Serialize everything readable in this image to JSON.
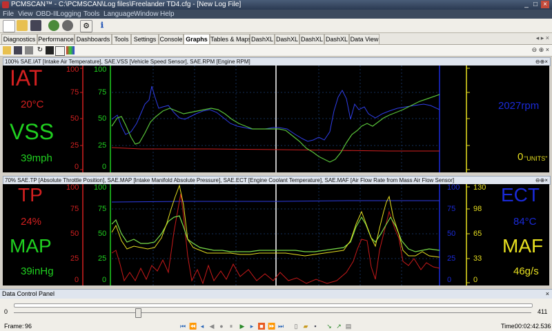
{
  "window": {
    "title": "PCMSCAN™ - C:\\PCMSCAN\\Log files\\Freelander TD4.cfg - [New Log File]"
  },
  "menu": [
    "File",
    "View",
    "OBD-II",
    "Logging",
    "Tools",
    "Language",
    "Window",
    "Help"
  ],
  "tabs": [
    "Diagnostics",
    "Performance",
    "Dashboards",
    "Tools",
    "Settings",
    "Console",
    "Graphs",
    "Tables & Maps",
    "DashXL",
    "DashXL",
    "DashXL",
    "DashXL",
    "Data View"
  ],
  "active_tab": "Graphs",
  "colors": {
    "red": "#d42020",
    "green": "#20d020",
    "blue": "#1a2ad8",
    "yellow": "#e8e020",
    "white": "#ffffff"
  },
  "graph1": {
    "header": "100% SAE.IAT [Intake Air Temperature], SAE.VSS [Vehicle Speed Sensor], SAE.RPM [Engine RPM]",
    "iat_label": "IAT",
    "iat_value": "20°C",
    "vss_label": "VSS",
    "vss_value": "39mph",
    "rpm_value": "2027rpm",
    "units_value": "0",
    "units_label": "\"UNITS\"",
    "red_axis": [
      "100",
      "75",
      "50",
      "25",
      "0"
    ],
    "green_axis": [
      "100",
      "75",
      "50",
      "25",
      "0"
    ]
  },
  "graph2": {
    "header": "70% SAE.TP [Absolute Throttle Position], SAE.MAP [Intake Manifold Absolute Pressure], SAE.ECT [Engine Coolant Temperature], SAE.MAF [Air Flow Rate from Mass Air Flow Sensor]",
    "tp_label": "TP",
    "tp_value": "24%",
    "map_label": "MAP",
    "map_value": "39inHg",
    "ect_label": "ECT",
    "ect_value": "84°C",
    "maf_label": "MAF",
    "maf_value": "46g/s",
    "red_axis": [
      "100",
      "75",
      "50",
      "25",
      "0"
    ],
    "green_axis": [
      "100",
      "75",
      "50",
      "25",
      "0"
    ],
    "blue_axis": [
      "100",
      "75",
      "50",
      "25",
      "0"
    ],
    "yellow_axis": [
      "130",
      "98",
      "65",
      "33",
      "0"
    ]
  },
  "data_control": {
    "title": "Data Control Panel",
    "min": "0",
    "max": "411",
    "frame_label": "Frame:",
    "frame_value": "96",
    "time_label": "Time:",
    "time_value": "00:02:42.536"
  }
}
